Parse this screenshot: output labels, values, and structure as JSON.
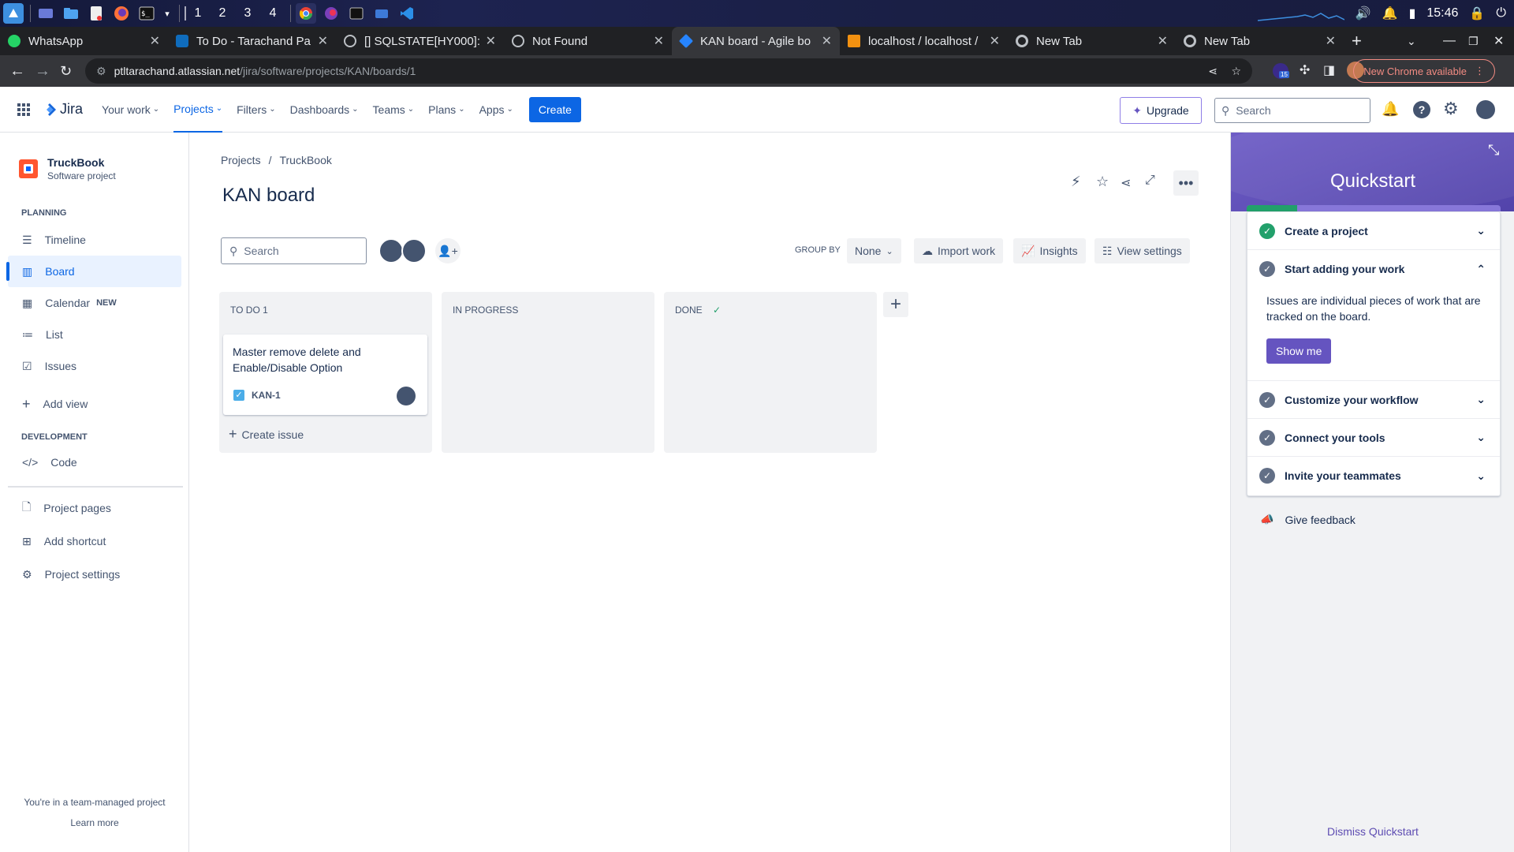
{
  "os": {
    "workspaces": [
      "1",
      "2",
      "3",
      "4"
    ],
    "clock": "15:46"
  },
  "browser": {
    "tabs": [
      {
        "title": "WhatsApp",
        "icon": "whatsapp-icon"
      },
      {
        "title": "To Do - Tarachand Pa",
        "icon": "outlook-icon"
      },
      {
        "title": "[] SQLSTATE[HY000]:",
        "icon": "globe-icon"
      },
      {
        "title": "Not Found",
        "icon": "globe-icon"
      },
      {
        "title": "KAN board - Agile bo",
        "icon": "jira-icon"
      },
      {
        "title": "localhost / localhost /",
        "icon": "phpmyadmin-icon"
      },
      {
        "title": "New Tab",
        "icon": "chrome-icon"
      },
      {
        "title": "New Tab",
        "icon": "chrome-icon"
      }
    ],
    "url_host": "ptltarachand.atlassian.net",
    "url_path": "/jira/software/projects/KAN/boards/1",
    "update_label": "New Chrome available",
    "extension_badge": "15"
  },
  "header": {
    "product": "Jira",
    "nav": [
      "Your work",
      "Projects",
      "Filters",
      "Dashboards",
      "Teams",
      "Plans",
      "Apps"
    ],
    "create": "Create",
    "upgrade": "Upgrade",
    "search_placeholder": "Search"
  },
  "sidebar": {
    "project_name": "TruckBook",
    "project_type": "Software project",
    "planning_heading": "PLANNING",
    "planning_items": [
      "Timeline",
      "Board",
      "Calendar",
      "List",
      "Issues"
    ],
    "calendar_badge": "NEW",
    "add_view": "Add view",
    "development_heading": "DEVELOPMENT",
    "code": "Code",
    "project_pages": "Project pages",
    "add_shortcut": "Add shortcut",
    "project_settings": "Project settings",
    "footer_text": "You're in a team-managed project",
    "learn_more": "Learn more"
  },
  "board": {
    "breadcrumb": [
      "Projects",
      "TruckBook"
    ],
    "title": "KAN board",
    "search_placeholder": "Search",
    "group_by_label": "GROUP BY",
    "group_by_value": "None",
    "import_work": "Import work",
    "insights": "Insights",
    "view_settings": "View settings",
    "columns": [
      {
        "title": "TO DO 1"
      },
      {
        "title": "IN PROGRESS"
      },
      {
        "title": "DONE"
      }
    ],
    "card": {
      "summary": "Master remove delete and Enable/Disable Option",
      "key": "KAN-1"
    },
    "create_issue": "Create issue"
  },
  "quickstart": {
    "title": "Quickstart",
    "items": [
      {
        "label": "Create a project",
        "status": "done"
      },
      {
        "label": "Start adding your work",
        "status": "pending"
      },
      {
        "label": "Customize your workflow",
        "status": "pending"
      },
      {
        "label": "Connect your tools",
        "status": "pending"
      },
      {
        "label": "Invite your teammates",
        "status": "pending"
      }
    ],
    "expanded_text": "Issues are individual pieces of work that are tracked on the board.",
    "show_me": "Show me",
    "give_feedback": "Give feedback",
    "dismiss": "Dismiss Quickstart",
    "colors": {
      "accent": "#6554c0",
      "success": "#22a06b",
      "jira_blue": "#0c66e4"
    }
  }
}
